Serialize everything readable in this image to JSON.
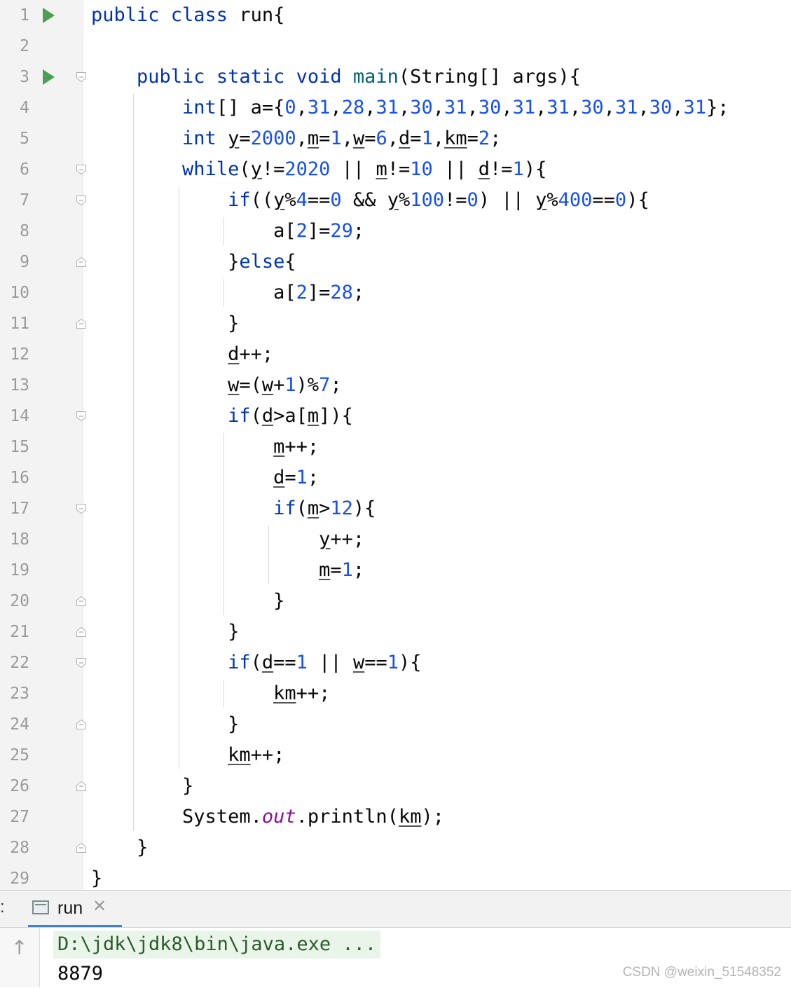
{
  "editor": {
    "line_numbers": [
      "1",
      "2",
      "3",
      "4",
      "5",
      "6",
      "7",
      "8",
      "9",
      "10",
      "11",
      "12",
      "13",
      "14",
      "15",
      "16",
      "17",
      "18",
      "19",
      "20",
      "21",
      "22",
      "23",
      "24",
      "25",
      "26",
      "27",
      "28",
      "29"
    ],
    "lines": [
      [
        {
          "t": "public class ",
          "c": "kw"
        },
        {
          "t": "run{",
          "c": ""
        }
      ],
      [],
      [
        {
          "t": "    ",
          "c": ""
        },
        {
          "t": "public static void ",
          "c": "kw"
        },
        {
          "t": "main",
          "c": "fn"
        },
        {
          "t": "(String[] args){",
          "c": ""
        }
      ],
      [
        {
          "t": "        ",
          "c": ""
        },
        {
          "t": "int",
          "c": "kw"
        },
        {
          "t": "[] a={",
          "c": ""
        },
        {
          "t": "0",
          "c": "num"
        },
        {
          "t": ",",
          "c": ""
        },
        {
          "t": "31",
          "c": "num"
        },
        {
          "t": ",",
          "c": ""
        },
        {
          "t": "28",
          "c": "num"
        },
        {
          "t": ",",
          "c": ""
        },
        {
          "t": "31",
          "c": "num"
        },
        {
          "t": ",",
          "c": ""
        },
        {
          "t": "30",
          "c": "num"
        },
        {
          "t": ",",
          "c": ""
        },
        {
          "t": "31",
          "c": "num"
        },
        {
          "t": ",",
          "c": ""
        },
        {
          "t": "30",
          "c": "num"
        },
        {
          "t": ",",
          "c": ""
        },
        {
          "t": "31",
          "c": "num"
        },
        {
          "t": ",",
          "c": ""
        },
        {
          "t": "31",
          "c": "num"
        },
        {
          "t": ",",
          "c": ""
        },
        {
          "t": "30",
          "c": "num"
        },
        {
          "t": ",",
          "c": ""
        },
        {
          "t": "31",
          "c": "num"
        },
        {
          "t": ",",
          "c": ""
        },
        {
          "t": "30",
          "c": "num"
        },
        {
          "t": ",",
          "c": ""
        },
        {
          "t": "31",
          "c": "num"
        },
        {
          "t": "};",
          "c": ""
        }
      ],
      [
        {
          "t": "        ",
          "c": ""
        },
        {
          "t": "int ",
          "c": "kw"
        },
        {
          "t": "y",
          "c": "u"
        },
        {
          "t": "=",
          "c": ""
        },
        {
          "t": "2000",
          "c": "num"
        },
        {
          "t": ",",
          "c": ""
        },
        {
          "t": "m",
          "c": "u"
        },
        {
          "t": "=",
          "c": ""
        },
        {
          "t": "1",
          "c": "num"
        },
        {
          "t": ",",
          "c": ""
        },
        {
          "t": "w",
          "c": "u"
        },
        {
          "t": "=",
          "c": ""
        },
        {
          "t": "6",
          "c": "num"
        },
        {
          "t": ",",
          "c": ""
        },
        {
          "t": "d",
          "c": "u"
        },
        {
          "t": "=",
          "c": ""
        },
        {
          "t": "1",
          "c": "num"
        },
        {
          "t": ",",
          "c": ""
        },
        {
          "t": "km",
          "c": "u"
        },
        {
          "t": "=",
          "c": ""
        },
        {
          "t": "2",
          "c": "num"
        },
        {
          "t": ";",
          "c": ""
        }
      ],
      [
        {
          "t": "        ",
          "c": ""
        },
        {
          "t": "while",
          "c": "kw"
        },
        {
          "t": "(",
          "c": ""
        },
        {
          "t": "y",
          "c": "u"
        },
        {
          "t": "!=",
          "c": ""
        },
        {
          "t": "2020",
          "c": "num"
        },
        {
          "t": " || ",
          "c": ""
        },
        {
          "t": "m",
          "c": "u"
        },
        {
          "t": "!=",
          "c": ""
        },
        {
          "t": "10",
          "c": "num"
        },
        {
          "t": " || ",
          "c": ""
        },
        {
          "t": "d",
          "c": "u"
        },
        {
          "t": "!=",
          "c": ""
        },
        {
          "t": "1",
          "c": "num"
        },
        {
          "t": "){",
          "c": ""
        }
      ],
      [
        {
          "t": "            ",
          "c": ""
        },
        {
          "t": "if",
          "c": "kw"
        },
        {
          "t": "((",
          "c": ""
        },
        {
          "t": "y",
          "c": "u"
        },
        {
          "t": "%",
          "c": ""
        },
        {
          "t": "4",
          "c": "num"
        },
        {
          "t": "==",
          "c": ""
        },
        {
          "t": "0",
          "c": "num"
        },
        {
          "t": " && ",
          "c": ""
        },
        {
          "t": "y",
          "c": "u"
        },
        {
          "t": "%",
          "c": ""
        },
        {
          "t": "100",
          "c": "num"
        },
        {
          "t": "!=",
          "c": ""
        },
        {
          "t": "0",
          "c": "num"
        },
        {
          "t": ") || ",
          "c": ""
        },
        {
          "t": "y",
          "c": "u"
        },
        {
          "t": "%",
          "c": ""
        },
        {
          "t": "400",
          "c": "num"
        },
        {
          "t": "==",
          "c": ""
        },
        {
          "t": "0",
          "c": "num"
        },
        {
          "t": "){",
          "c": ""
        }
      ],
      [
        {
          "t": "                a[",
          "c": ""
        },
        {
          "t": "2",
          "c": "num"
        },
        {
          "t": "]=",
          "c": ""
        },
        {
          "t": "29",
          "c": "num"
        },
        {
          "t": ";",
          "c": ""
        }
      ],
      [
        {
          "t": "            }",
          "c": ""
        },
        {
          "t": "else",
          "c": "kw"
        },
        {
          "t": "{",
          "c": ""
        }
      ],
      [
        {
          "t": "                a[",
          "c": ""
        },
        {
          "t": "2",
          "c": "num"
        },
        {
          "t": "]=",
          "c": ""
        },
        {
          "t": "28",
          "c": "num"
        },
        {
          "t": ";",
          "c": ""
        }
      ],
      [
        {
          "t": "            }",
          "c": ""
        }
      ],
      [
        {
          "t": "            ",
          "c": ""
        },
        {
          "t": "d",
          "c": "u"
        },
        {
          "t": "++;",
          "c": ""
        }
      ],
      [
        {
          "t": "            ",
          "c": ""
        },
        {
          "t": "w",
          "c": "u"
        },
        {
          "t": "=(",
          "c": ""
        },
        {
          "t": "w",
          "c": "u"
        },
        {
          "t": "+",
          "c": ""
        },
        {
          "t": "1",
          "c": "num"
        },
        {
          "t": ")%",
          "c": ""
        },
        {
          "t": "7",
          "c": "num"
        },
        {
          "t": ";",
          "c": ""
        }
      ],
      [
        {
          "t": "            ",
          "c": ""
        },
        {
          "t": "if",
          "c": "kw"
        },
        {
          "t": "(",
          "c": ""
        },
        {
          "t": "d",
          "c": "u"
        },
        {
          "t": ">a[",
          "c": ""
        },
        {
          "t": "m",
          "c": "u"
        },
        {
          "t": "]){",
          "c": ""
        }
      ],
      [
        {
          "t": "                ",
          "c": ""
        },
        {
          "t": "m",
          "c": "u"
        },
        {
          "t": "++;",
          "c": ""
        }
      ],
      [
        {
          "t": "                ",
          "c": ""
        },
        {
          "t": "d",
          "c": "u"
        },
        {
          "t": "=",
          "c": ""
        },
        {
          "t": "1",
          "c": "num"
        },
        {
          "t": ";",
          "c": ""
        }
      ],
      [
        {
          "t": "                ",
          "c": ""
        },
        {
          "t": "if",
          "c": "kw"
        },
        {
          "t": "(",
          "c": ""
        },
        {
          "t": "m",
          "c": "u"
        },
        {
          "t": ">",
          "c": ""
        },
        {
          "t": "12",
          "c": "num"
        },
        {
          "t": "){",
          "c": ""
        }
      ],
      [
        {
          "t": "                    ",
          "c": ""
        },
        {
          "t": "y",
          "c": "u"
        },
        {
          "t": "++;",
          "c": ""
        }
      ],
      [
        {
          "t": "                    ",
          "c": ""
        },
        {
          "t": "m",
          "c": "u"
        },
        {
          "t": "=",
          "c": ""
        },
        {
          "t": "1",
          "c": "num"
        },
        {
          "t": ";",
          "c": ""
        }
      ],
      [
        {
          "t": "                }",
          "c": ""
        }
      ],
      [
        {
          "t": "            }",
          "c": ""
        }
      ],
      [
        {
          "t": "            ",
          "c": ""
        },
        {
          "t": "if",
          "c": "kw"
        },
        {
          "t": "(",
          "c": ""
        },
        {
          "t": "d",
          "c": "u"
        },
        {
          "t": "==",
          "c": ""
        },
        {
          "t": "1",
          "c": "num"
        },
        {
          "t": " || ",
          "c": ""
        },
        {
          "t": "w",
          "c": "u"
        },
        {
          "t": "==",
          "c": ""
        },
        {
          "t": "1",
          "c": "num"
        },
        {
          "t": "){",
          "c": ""
        }
      ],
      [
        {
          "t": "                ",
          "c": ""
        },
        {
          "t": "km",
          "c": "u"
        },
        {
          "t": "++;",
          "c": ""
        }
      ],
      [
        {
          "t": "            }",
          "c": ""
        }
      ],
      [
        {
          "t": "            ",
          "c": ""
        },
        {
          "t": "km",
          "c": "u"
        },
        {
          "t": "++;",
          "c": ""
        }
      ],
      [
        {
          "t": "        }",
          "c": ""
        }
      ],
      [
        {
          "t": "        System.",
          "c": ""
        },
        {
          "t": "out",
          "c": "fld"
        },
        {
          "t": ".println(",
          "c": ""
        },
        {
          "t": "km",
          "c": "u"
        },
        {
          "t": ");",
          "c": ""
        }
      ],
      [
        {
          "t": "    }",
          "c": ""
        }
      ],
      [
        {
          "t": "}",
          "c": ""
        }
      ]
    ],
    "run_lines": [
      1,
      3
    ],
    "fold_open_lines": [
      3,
      6,
      7,
      14,
      17,
      22
    ],
    "fold_close_lines": [
      9,
      11,
      20,
      21,
      24,
      26,
      28
    ]
  },
  "run_panel": {
    "colon": ":",
    "tab_label": "run",
    "tab_close": "✕",
    "up_arrow": "↑"
  },
  "console": {
    "command": "D:\\jdk\\jdk8\\bin\\java.exe ...",
    "output": "8879"
  },
  "watermark": "CSDN @weixin_51548352",
  "colors": {
    "keyword": "#0033b3",
    "number": "#1750eb",
    "method": "#00627a",
    "static_field": "#871094",
    "run_icon": "#4a9f53",
    "tab_underline": "#4083c9"
  }
}
